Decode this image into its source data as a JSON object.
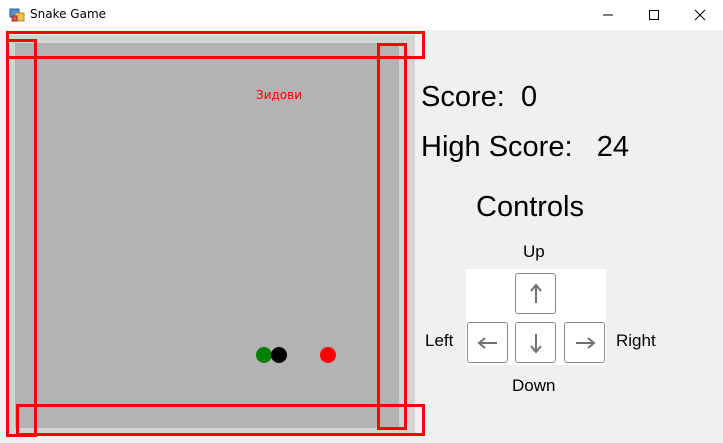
{
  "window": {
    "title": "Snake Game"
  },
  "game": {
    "player_name": "Зидови",
    "snake_head_color": "#008000",
    "snake_body_color": "#000000",
    "food_color": "#ff0000",
    "board_color": "#b3b3b3"
  },
  "scores": {
    "score_label": "Score:",
    "score_value": "0",
    "high_score_label": "High Score:",
    "high_score_value": "24"
  },
  "controls": {
    "title": "Controls",
    "up": "Up",
    "down": "Down",
    "left": "Left",
    "right": "Right"
  },
  "annotations": {
    "highlight_color": "#ff0000"
  }
}
